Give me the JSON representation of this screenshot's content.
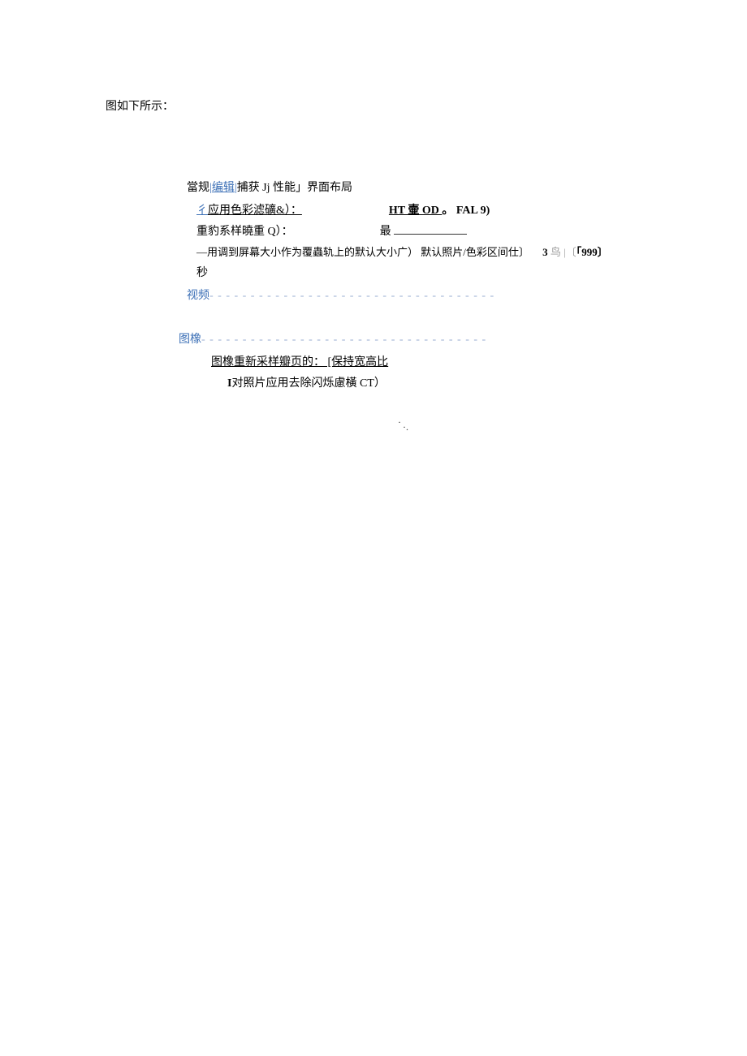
{
  "intro": "图如下所示：",
  "tabs": {
    "t1": "當规",
    "sep1": "|",
    "t2": "编辑",
    "sep2": "|",
    "t3": "捕获",
    "t4": "Jj",
    "t5": "性能」界面布局"
  },
  "row1": {
    "leading": "彳",
    "label": "应用色彩滤礦&）：",
    "right_a": "HT 壷 OD ",
    "right_b": "。 FAL 9)"
  },
  "row2": {
    "label": "重豹系样曉重 Q）：",
    "right": "最"
  },
  "row3": {
    "a": "—用调到屏幕大小作为覆蟲轨上的默认大小广）  默认照片/色彩区间仕〕",
    "b": "3",
    "c": " 鸟 |〔",
    "d": "「999〕"
  },
  "row4": "秒",
  "sections": {
    "video": "视频",
    "image": "图橡",
    "dashes": "- - - - - - - - - - - - - - - - - - - - - - - - - - - - - - - - - - -"
  },
  "img_row1": "图橡重新采样瓣页的：   [保持宽高比",
  "img_row2_a": "I",
  "img_row2_b": "对照片应用去除闪烁慮橫 CT）",
  "dots": {
    "d1": "·",
    "d2": "·."
  }
}
